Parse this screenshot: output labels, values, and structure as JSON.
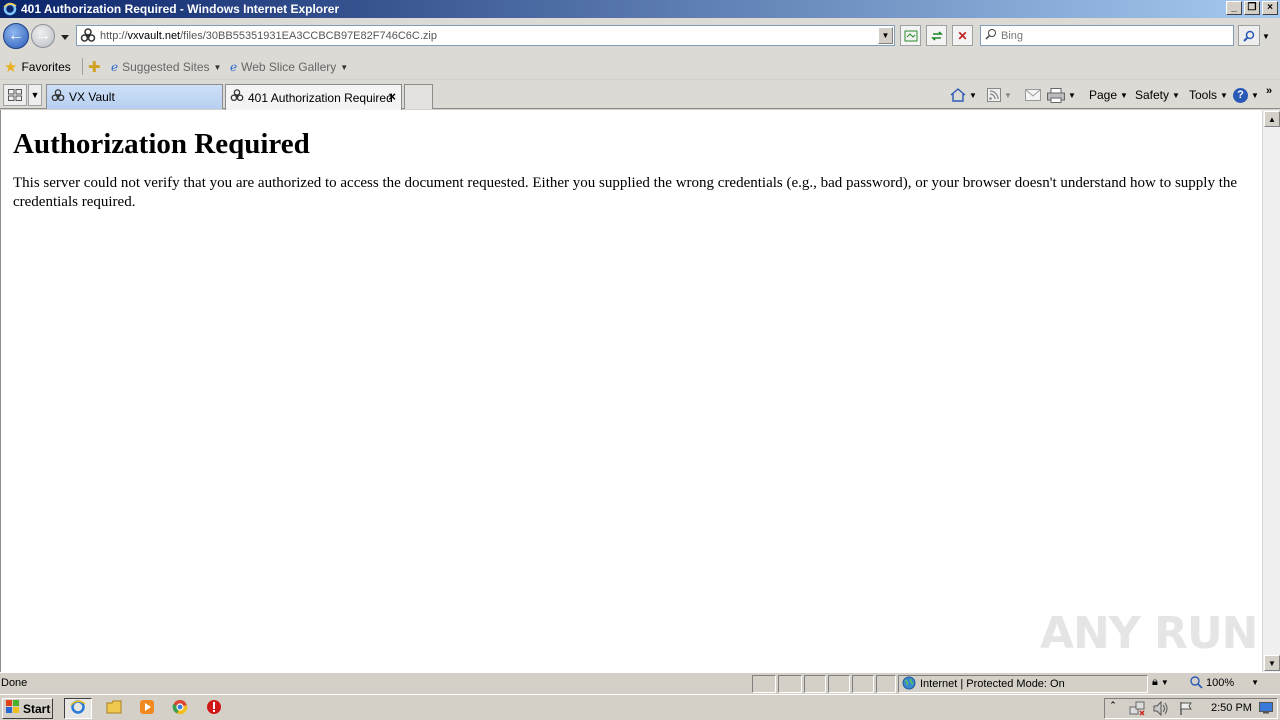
{
  "window": {
    "title": "401 Authorization Required - Windows Internet Explorer",
    "controls": [
      "minimize",
      "restore",
      "close"
    ]
  },
  "address_bar": {
    "url_prefix": "http://",
    "url_domain": "vxvault.net",
    "url_path": "/files/30BB55351931EA3CCBCB97E82F746C6C.zip"
  },
  "search": {
    "placeholder": "Bing"
  },
  "favorites_bar": {
    "favorites_label": "Favorites",
    "items": [
      {
        "label": "Suggested Sites",
        "icon": "ie-page-icon"
      },
      {
        "label": "Web Slice Gallery",
        "icon": "ie-page-icon"
      }
    ]
  },
  "tabs": [
    {
      "label": "VX Vault",
      "active": false,
      "icon": "biohazard-icon"
    },
    {
      "label": "401 Authorization Required",
      "active": true,
      "icon": "biohazard-icon",
      "close": "×"
    }
  ],
  "command_bar": {
    "page": "Page",
    "safety": "Safety",
    "tools": "Tools"
  },
  "page": {
    "heading": "Authorization Required",
    "body": "This server could not verify that you are authorized to access the document requested. Either you supplied the wrong credentials (e.g., bad password), or your browser doesn't understand how to supply the credentials required."
  },
  "watermark": "ANY RUN",
  "status_bar": {
    "text": "Done",
    "zone": "Internet | Protected Mode: On",
    "zoom": "100%"
  },
  "taskbar": {
    "start_label": "Start",
    "clock": "2:50 PM",
    "pinned": [
      "internet-explorer-icon",
      "folder-icon",
      "media-player-icon",
      "chrome-icon",
      "stop-icon"
    ]
  },
  "colors": {
    "titlebar_start": "#0a246a",
    "titlebar_end": "#a6caf0",
    "chrome_bg": "#dcdad5",
    "content_bg": "#ffffff"
  }
}
